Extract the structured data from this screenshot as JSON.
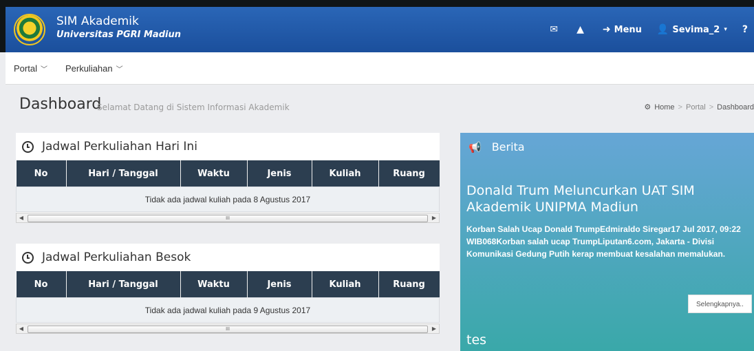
{
  "header": {
    "app_title": "SIM Akademik",
    "subtitle": "Universitas PGRI Madiun",
    "menu_label": "Menu",
    "user_label": "Sevima_2",
    "icons": [
      "envelope-icon",
      "alert-icon",
      "signin-icon",
      "user-icon",
      "help-icon"
    ]
  },
  "nav": {
    "items": [
      {
        "label": "Portal"
      },
      {
        "label": "Perkuliahan"
      }
    ]
  },
  "page": {
    "title": "Dashboard",
    "subtitle": "Selamat Datang di Sistem Informasi Akademik"
  },
  "breadcrumb": {
    "home": "Home",
    "portal": "Portal",
    "current": "Dashboard"
  },
  "schedule_today": {
    "title": "Jadwal Perkuliahan Hari Ini",
    "columns": [
      "No",
      "Hari / Tanggal",
      "Waktu",
      "Jenis",
      "Kuliah",
      "Ruang"
    ],
    "empty_message": "Tidak ada jadwal kuliah pada 8 Agustus 2017"
  },
  "schedule_tomorrow": {
    "title": "Jadwal Perkuliahan Besok",
    "columns": [
      "No",
      "Hari / Tanggal",
      "Waktu",
      "Jenis",
      "Kuliah",
      "Ruang"
    ],
    "empty_message": "Tidak ada jadwal kuliah pada 9 Agustus 2017"
  },
  "news": {
    "heading": "Berita",
    "headline": "Donald Trum Meluncurkan UAT SIM Akademik UNIPMA Madiun",
    "body": "Korban Salah Ucap Donald TrumpEdmiraldo Siregar17 Jul 2017, 09:22 WIB068Korban salah ucap TrumpLiputan6.com, Jakarta - Divisi Komunikasi Gedung Putih kerap membuat kesalahan memalukan.",
    "more_label": "Selengkapnya..",
    "headline2": "tes"
  },
  "scrollbar": {
    "thumb_grip": "III"
  },
  "colors": {
    "header_bg": "#1f58a8",
    "table_header": "#2c3e50",
    "news_top": "#66a6d6",
    "news_bottom": "#3aa8a9"
  }
}
